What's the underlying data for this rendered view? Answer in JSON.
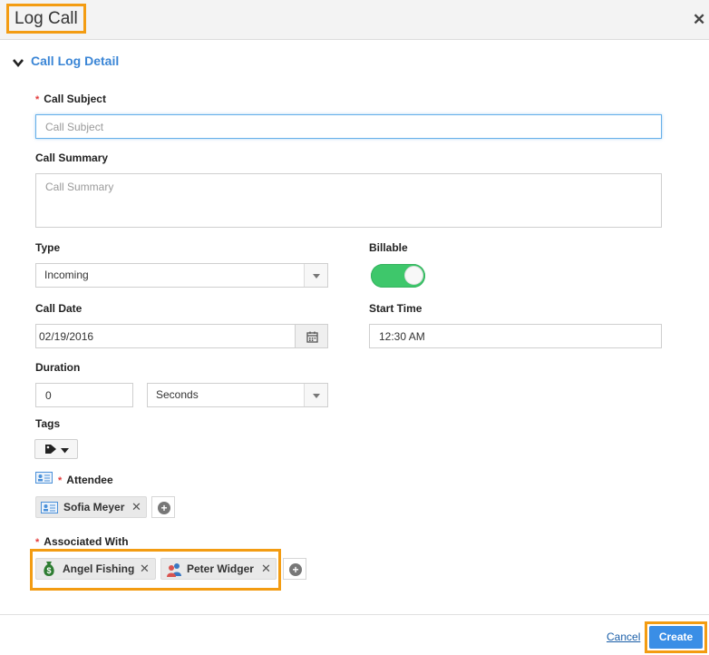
{
  "dialog": {
    "title": "Log Call",
    "close_glyph": "✕"
  },
  "section": {
    "title": "Call Log Detail",
    "toggle_icon": "chevron-down-icon"
  },
  "required_marker": "*",
  "fields": {
    "call_subject": {
      "label": "Call Subject",
      "placeholder": "Call Subject",
      "value": ""
    },
    "call_summary": {
      "label": "Call Summary",
      "placeholder": "Call Summary",
      "value": ""
    },
    "type": {
      "label": "Type",
      "value": "Incoming"
    },
    "billable": {
      "label": "Billable",
      "on": true,
      "color": "#3ec76b"
    },
    "call_date": {
      "label": "Call Date",
      "value": "02/19/2016"
    },
    "start_time": {
      "label": "Start Time",
      "value": "12:30 AM"
    },
    "duration": {
      "label": "Duration",
      "value": "0",
      "unit": "Seconds"
    },
    "tags": {
      "label": "Tags"
    },
    "attendee": {
      "label": "Attendee",
      "chips": [
        {
          "name": "Sofia Meyer",
          "icon": "contact-card-icon"
        }
      ]
    },
    "associated_with": {
      "label": "Associated With",
      "chips": [
        {
          "name": "Angel Fishing",
          "icon": "money-bag-icon"
        },
        {
          "name": "Peter Widger",
          "icon": "contacts-people-icon"
        }
      ]
    }
  },
  "footer": {
    "cancel_label": "Cancel",
    "create_label": "Create"
  },
  "colors": {
    "accent": "#3b86d6",
    "highlight": "#f39c12",
    "primary_button": "#3a8ee6",
    "required": "#e33b3b"
  }
}
